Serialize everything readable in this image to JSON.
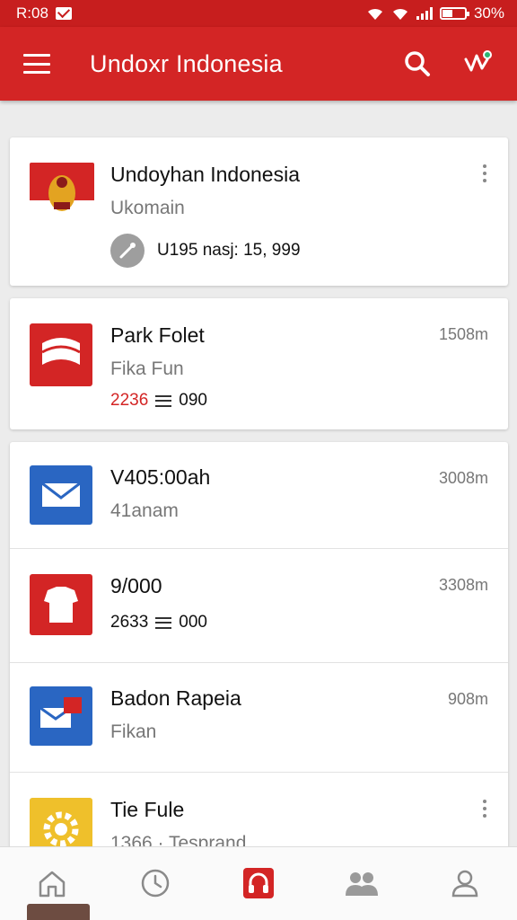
{
  "status_bar": {
    "time": "R:08",
    "battery": "30%"
  },
  "app_bar": {
    "title": "Undoxr Indonesia",
    "menu_icon": "menu-icon",
    "search_icon": "search-icon",
    "action_icon": "activity-icon"
  },
  "items": [
    {
      "title": "Undoyhan Indonesia",
      "subtitle": "Ukomain",
      "meta": "U195 nasj: 15, 999",
      "icon": "flag-emblem-icon",
      "color": "#d32525",
      "trailing": "more-icon"
    },
    {
      "title": "Park Folet",
      "subtitle": "Fika Fun",
      "meta_red": "2236",
      "meta": "090",
      "right": "1508m",
      "icon": "wave-flag-icon",
      "color": "#d32525"
    },
    {
      "title": "V405:00ah",
      "subtitle": "41anam",
      "right": "3008m",
      "icon": "mail-icon",
      "color": "#2a66c2"
    },
    {
      "title": "9/000",
      "meta_prefix": "2633",
      "meta": "000",
      "right": "3308m",
      "icon": "shirt-icon",
      "color": "#d32525"
    },
    {
      "title": "Badon Rapeia",
      "subtitle": "Fikan",
      "right": "908m",
      "icon": "mail-red-icon",
      "color": "#2a66c2"
    },
    {
      "title": "Tie Fule",
      "subtitle": "1366 · Tesprand",
      "icon": "gear-icon",
      "color": "#efc02b",
      "trailing": "more-icon"
    }
  ],
  "bottom_nav": [
    {
      "name": "home-icon"
    },
    {
      "name": "clock-icon"
    },
    {
      "name": "headphones-icon",
      "active": true,
      "color": "#d32525"
    },
    {
      "name": "group-icon"
    },
    {
      "name": "profile-icon"
    }
  ]
}
